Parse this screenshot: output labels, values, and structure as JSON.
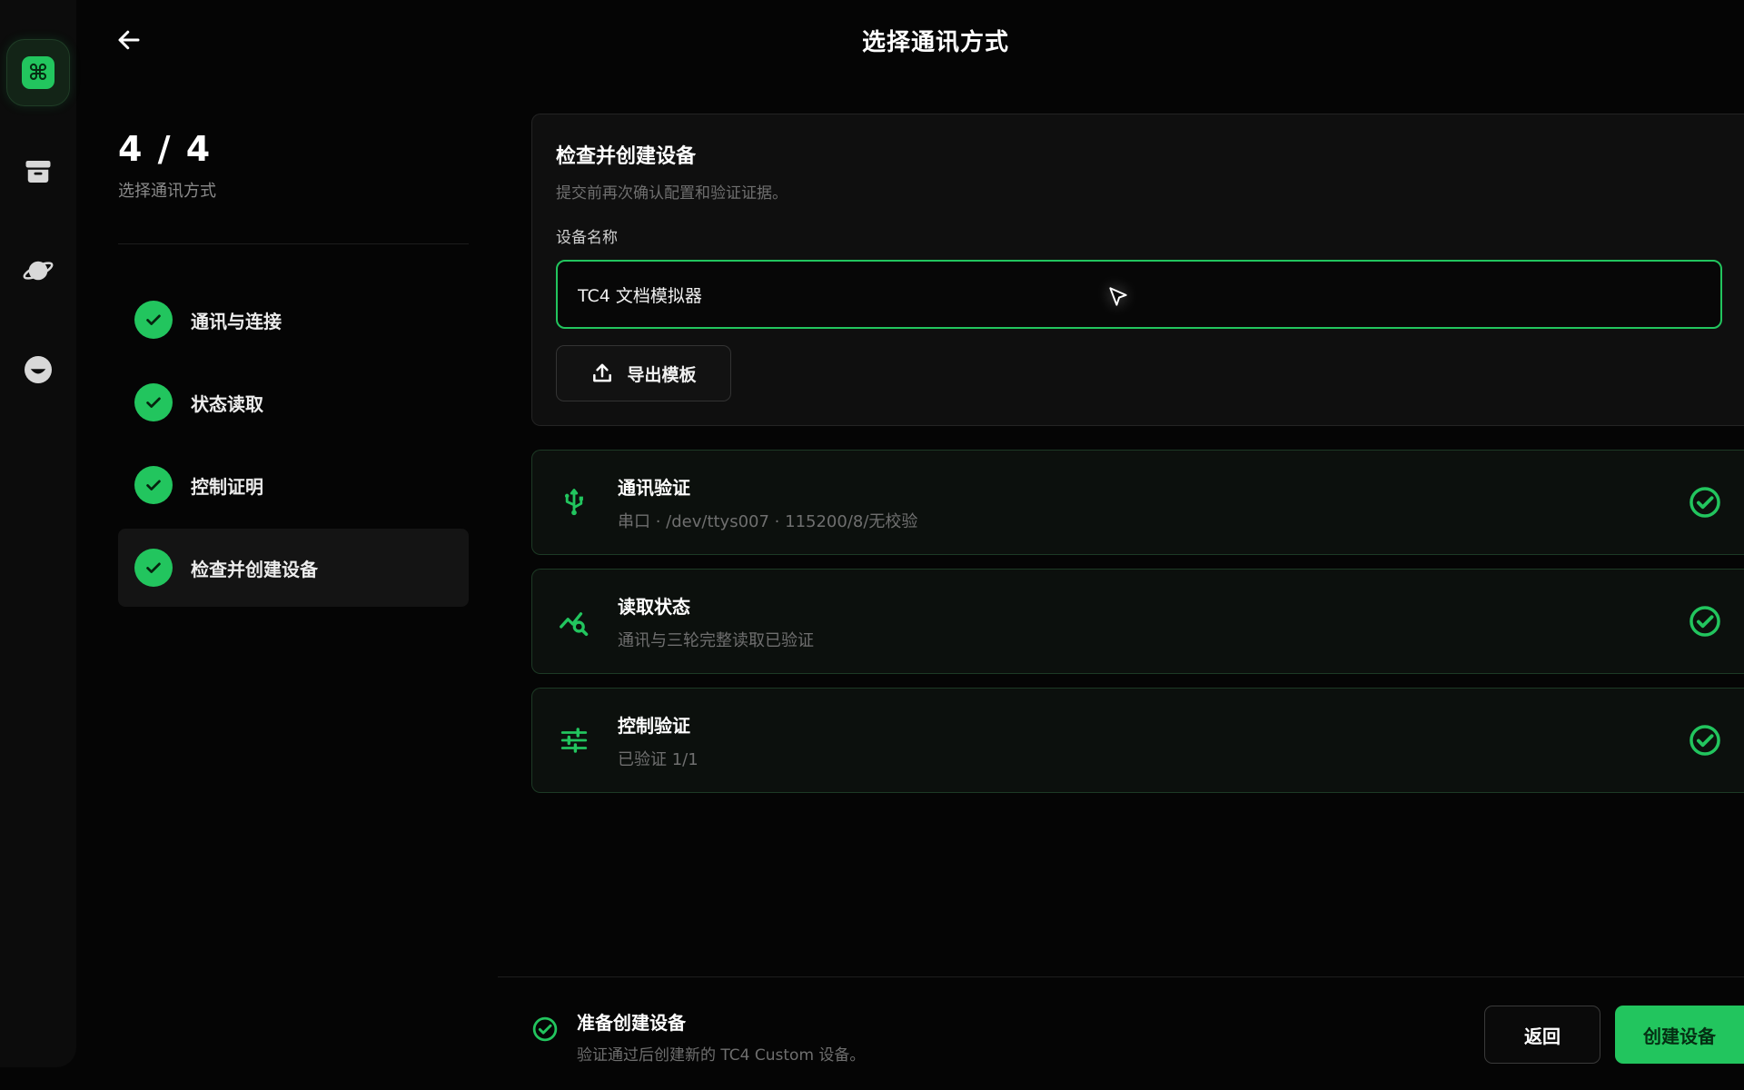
{
  "header": {
    "title": "选择通讯方式",
    "back_icon": "arrow-left-icon"
  },
  "rail": {
    "items": [
      {
        "icon": "command-icon",
        "active": true
      },
      {
        "icon": "archive-icon",
        "active": false
      },
      {
        "icon": "planet-icon",
        "active": false
      },
      {
        "icon": "face-icon",
        "active": false
      }
    ]
  },
  "steps": {
    "counter": "4 / 4",
    "subtitle": "选择通讯方式",
    "items": [
      {
        "label": "通讯与连接",
        "done": true
      },
      {
        "label": "状态读取",
        "done": true
      },
      {
        "label": "控制证明",
        "done": true
      },
      {
        "label": "检查并创建设备",
        "done": true,
        "current": true
      }
    ]
  },
  "review": {
    "title": "检查并创建设备",
    "description": "提交前再次确认配置和验证证据。",
    "field_label": "设备名称",
    "device_name": "TC4 文档模拟器",
    "export_label": "导出模板"
  },
  "verifications": [
    {
      "icon": "usb-icon",
      "title": "通讯验证",
      "detail": "串口 · /dev/ttys007 · 115200/8/无校验",
      "status": "verified"
    },
    {
      "icon": "chart-search-icon",
      "title": "读取状态",
      "detail": "通讯与三轮完整读取已验证",
      "status": "verified"
    },
    {
      "icon": "sliders-icon",
      "title": "控制验证",
      "detail": "已验证 1/1",
      "status": "verified"
    }
  ],
  "footer": {
    "status_title": "准备创建设备",
    "status_desc": "验证通过后创建新的 TC4 Custom 设备。",
    "back_label": "返回",
    "create_label": "创建设备"
  },
  "colors": {
    "accent": "#22c55e",
    "background": "#050505",
    "card": "#0f0f0f",
    "muted_text": "#6f6f6f"
  }
}
